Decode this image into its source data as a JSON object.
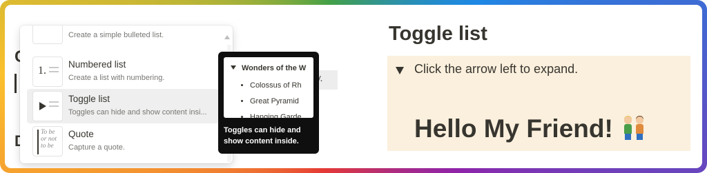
{
  "underlying_page": {
    "heading_fragment": "C",
    "heading2_fragment": "D",
    "tail_fragment": "y."
  },
  "slash_menu": {
    "items": [
      {
        "title": "",
        "description": "Create a simple bulleted list.",
        "icon": "bulleted-list-icon"
      },
      {
        "title": "Numbered list",
        "description": "Create a list with numbering.",
        "icon": "numbered-list-icon",
        "glyph": "1."
      },
      {
        "title": "Toggle list",
        "description": "Toggles can hide and show content insi...",
        "icon": "toggle-list-icon",
        "active": true
      },
      {
        "title": "Quote",
        "description": "Capture a quote.",
        "icon": "quote-icon",
        "glyph_lines": [
          "To be",
          "or not",
          "to be"
        ]
      }
    ]
  },
  "tooltip": {
    "preview_title": "Wonders of the W",
    "preview_items": [
      "Colossus of Rh",
      "Great Pyramid",
      "Hanging Garde"
    ],
    "description": "Toggles can hide and show content inside."
  },
  "right_panel": {
    "title": "Toggle list",
    "instruction": "Click the arrow left to expand.",
    "hello": "Hello My Friend!",
    "emoji_icon": "two-people-holding-hands-icon",
    "background_color": "#fbf0dd"
  }
}
